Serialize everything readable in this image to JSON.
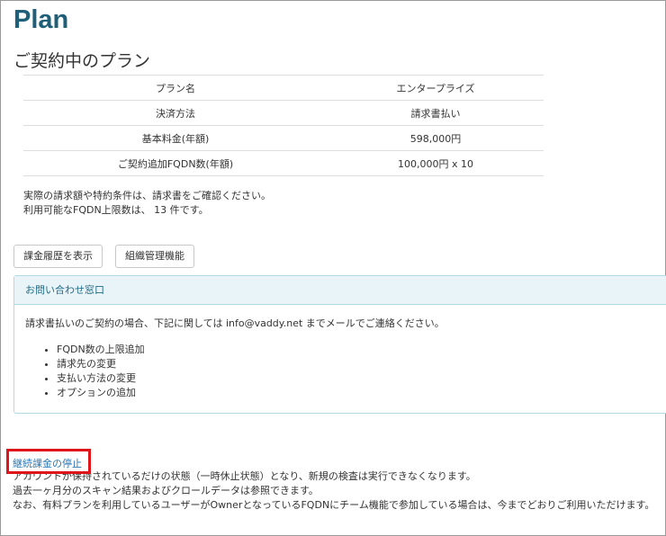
{
  "page": {
    "title": "Plan",
    "subtitle": "ご契約中のプラン"
  },
  "plan_table": [
    {
      "label": "プラン名",
      "value": "エンタープライズ"
    },
    {
      "label": "決済方法",
      "value": "請求書払い"
    },
    {
      "label": "基本料金(年額)",
      "value": "598,000円"
    },
    {
      "label": "ご契約追加FQDN数(年額)",
      "value": "100,000円 x 10"
    }
  ],
  "notes": [
    "実際の請求額や特約条件は、請求書をご確認ください。",
    "利用可能なFQDN上限数は、 13 件です。"
  ],
  "buttons": {
    "billing_history": "課金履歴を表示",
    "org_management": "組織管理機能"
  },
  "contact": {
    "heading": "お問い合わせ窓口",
    "intro": "請求書払いのご契約の場合、下記に関しては info@vaddy.net までメールでご連絡ください。",
    "items": [
      "FQDN数の上限追加",
      "請求先の変更",
      "支払い方法の変更",
      "オプションの追加"
    ]
  },
  "stop": {
    "link": "継続課金の停止",
    "lines": [
      "アカウントが保持されているだけの状態（一時休止状態）となり、新規の検査は実行できなくなります。",
      "過去一ヶ月分のスキャン結果およびクロールデータは参照できます。",
      "なお、有料プランを利用しているユーザーがOwnerとなっているFQDNにチーム機能で参加している場合は、今までどおりご利用いただけます。"
    ]
  },
  "colors": {
    "title": "#1f5f78",
    "link": "#2a77b5",
    "panel_border": "#b5d9e4",
    "highlight": "#e0141b"
  }
}
